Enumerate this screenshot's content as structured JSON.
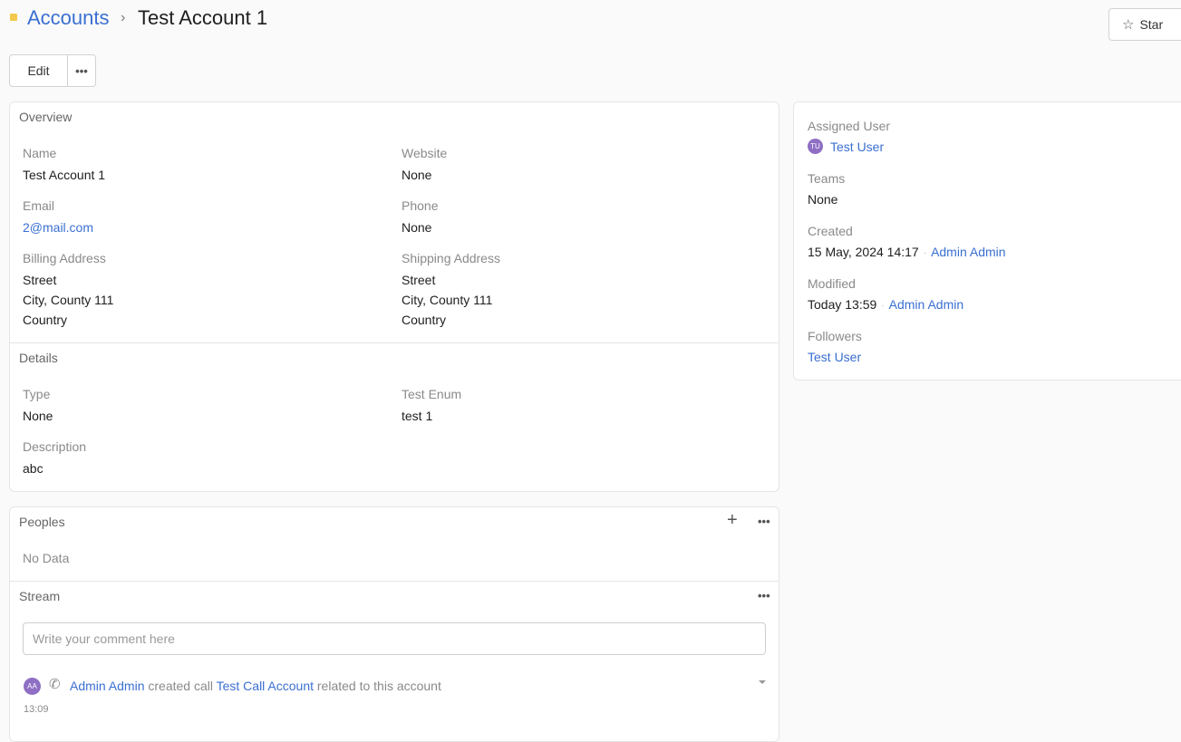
{
  "breadcrumb": {
    "parent": "Accounts",
    "separator": "›",
    "current": "Test Account 1"
  },
  "header": {
    "star_label": "Star",
    "star_icon": "star-outline-icon"
  },
  "toolbar": {
    "edit_label": "Edit",
    "more_label": "•••"
  },
  "overview": {
    "title": "Overview",
    "name_label": "Name",
    "name_value": "Test Account 1",
    "website_label": "Website",
    "website_value": "None",
    "email_label": "Email",
    "email_value": "2@mail.com",
    "phone_label": "Phone",
    "phone_value": "None",
    "billing_label": "Billing Address",
    "billing_street": "Street",
    "billing_city": "City, County 111",
    "billing_country": "Country",
    "shipping_label": "Shipping Address",
    "shipping_street": "Street",
    "shipping_city": "City, County 111",
    "shipping_country": "Country"
  },
  "details": {
    "title": "Details",
    "type_label": "Type",
    "type_value": "None",
    "test_enum_label": "Test Enum",
    "test_enum_value": "test 1",
    "description_label": "Description",
    "description_value": "abc"
  },
  "peoples": {
    "title": "Peoples",
    "add_label": "+",
    "more_label": "•••",
    "empty_text": "No Data"
  },
  "stream": {
    "title": "Stream",
    "more_label": "•••",
    "comment_placeholder": "Write your comment here",
    "entry": {
      "avatar_initials": "AA",
      "user": "Admin Admin",
      "action_text": "created call",
      "target": "Test Call Account",
      "suffix_text": "related to this account",
      "time": "13:09"
    }
  },
  "side": {
    "assigned_label": "Assigned User",
    "assigned_avatar": "TU",
    "assigned_value": "Test User",
    "teams_label": "Teams",
    "teams_value": "None",
    "created_label": "Created",
    "created_date": "15 May, 2024 14:17",
    "created_by": "Admin Admin",
    "modified_label": "Modified",
    "modified_date": "Today 13:59",
    "modified_by": "Admin Admin",
    "followers_label": "Followers",
    "followers_value": "Test User",
    "separator": "·"
  },
  "colors": {
    "link": "#3a6fd1",
    "accent_square": "#f2c94c",
    "avatar": "#8e6fc4"
  }
}
